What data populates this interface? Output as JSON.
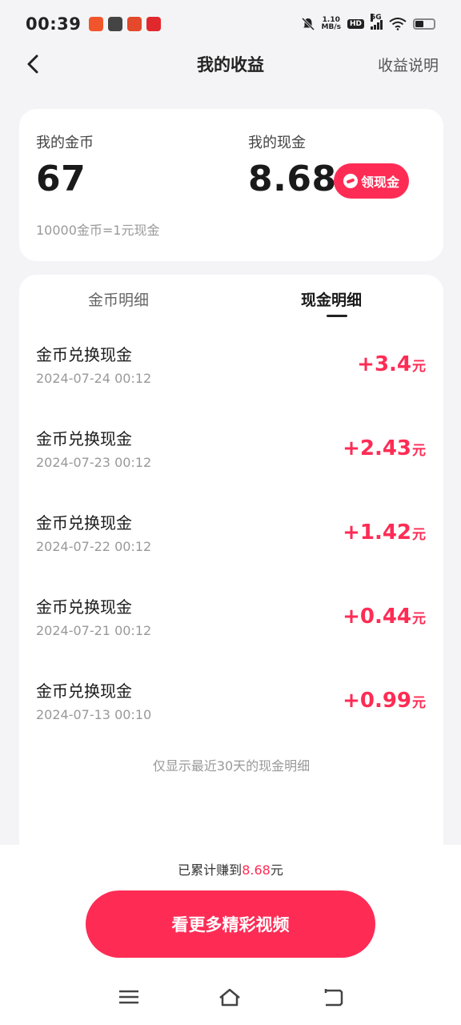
{
  "status_bar": {
    "time": "00:39",
    "net_speed_value": "1.10",
    "net_speed_unit": "MB/s",
    "hd": "HD",
    "network": "5G",
    "app_badge_colors": [
      "#f0552b",
      "#444444",
      "#e3492a",
      "#e0282d"
    ]
  },
  "nav": {
    "title": "我的收益",
    "right_link": "收益说明"
  },
  "summary": {
    "coins_label": "我的金币",
    "coins_value": "67",
    "cash_label": "我的现金",
    "cash_value": "8.68",
    "withdraw_label": "领现金",
    "exchange_rate": "10000金币=1元现金"
  },
  "tabs": {
    "coins": "金币明细",
    "cash": "现金明细",
    "active": "cash"
  },
  "records": [
    {
      "title": "金币兑换现金",
      "date": "2024-07-24 00:12",
      "amount": "+3.4",
      "unit": "元"
    },
    {
      "title": "金币兑换现金",
      "date": "2024-07-23 00:12",
      "amount": "+2.43",
      "unit": "元"
    },
    {
      "title": "金币兑换现金",
      "date": "2024-07-22 00:12",
      "amount": "+1.42",
      "unit": "元"
    },
    {
      "title": "金币兑换现金",
      "date": "2024-07-21 00:12",
      "amount": "+0.44",
      "unit": "元"
    },
    {
      "title": "金币兑换现金",
      "date": "2024-07-13 00:10",
      "amount": "+0.99",
      "unit": "元"
    }
  ],
  "footnote": "仅显示最近30天的现金明细",
  "bottom": {
    "earned_prefix": "已累计赚到",
    "earned_amount": "8.68",
    "earned_suffix": "元",
    "cta_label": "看更多精彩视频"
  },
  "colors": {
    "accent": "#fe2c55",
    "page_bg": "#f4f4f6",
    "card_bg": "#ffffff"
  },
  "icons": {
    "back": "chevron-left-icon",
    "withdraw": "wallet-icon",
    "sys_menu": "menu-icon",
    "sys_home": "home-icon",
    "sys_back": "back-icon"
  }
}
